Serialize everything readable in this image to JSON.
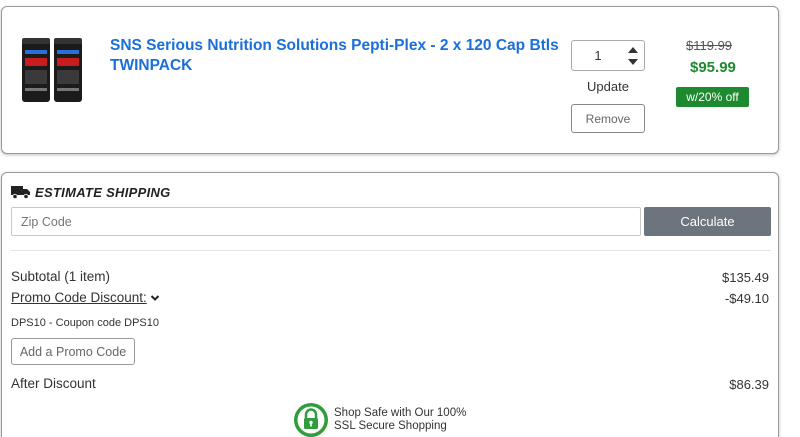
{
  "product": {
    "title": "SNS Serious Nutrition Solutions Pepti-Plex - 2 x 120 Cap Btls TWINPACK",
    "quantity": "1",
    "update_label": "Update",
    "remove_label": "Remove",
    "original_price": "$119.99",
    "sale_price": "$95.99",
    "discount_badge": "w/20% off",
    "image_brand_text": "SNS",
    "image_product_text": "PEPTI-PLEX"
  },
  "shipping": {
    "title": "ESTIMATE SHIPPING",
    "zip_placeholder": "Zip Code",
    "calculate_label": "Calculate"
  },
  "summary": {
    "subtotal_label": "Subtotal (1 item)",
    "subtotal_value": "$135.49",
    "promo_label": "Promo Code Discount:",
    "promo_value": "-$49.10",
    "coupon_note": "DPS10 - Coupon code DPS10",
    "add_promo_label": "Add a Promo Code",
    "after_discount_label": "After Discount",
    "after_discount_value": "$86.39"
  },
  "secure": {
    "line1": "Shop Safe with Our 100%",
    "line2": "SSL Secure Shopping"
  },
  "colors": {
    "link_blue": "#1a6fd8",
    "price_green": "#1e8a2f",
    "button_gray": "#6c757d"
  },
  "icons": [
    "truck-icon",
    "chevron-down-icon",
    "lock-icon",
    "spinner-up-icon",
    "spinner-down-icon"
  ]
}
